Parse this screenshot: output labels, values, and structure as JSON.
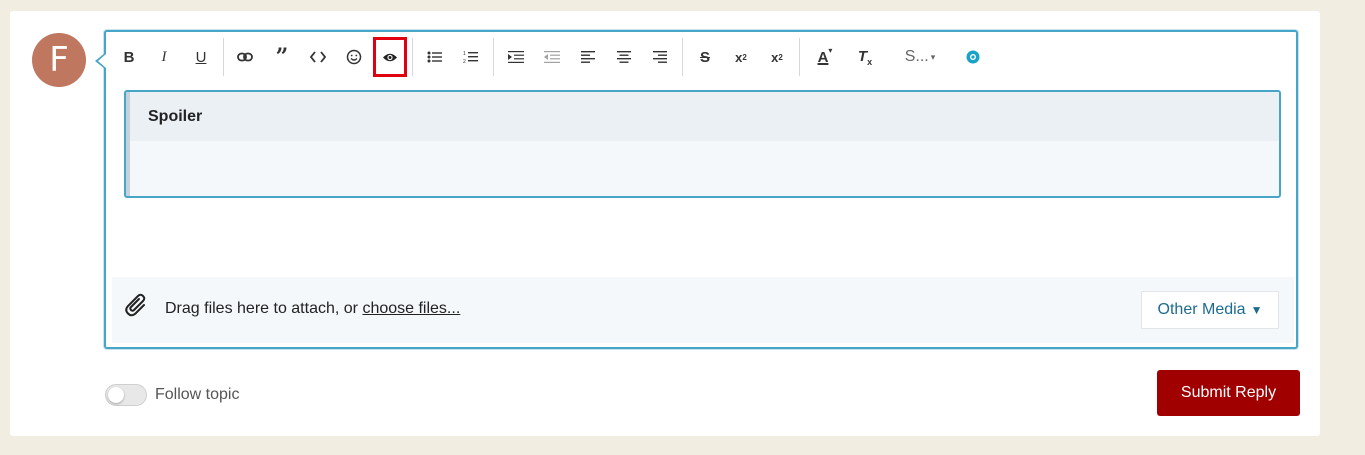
{
  "avatar": {
    "initial": "F",
    "color": "#c0775f"
  },
  "toolbar": {
    "buttons": [
      {
        "name": "bold",
        "glyph": "B"
      },
      {
        "name": "italic",
        "glyph": "I"
      },
      {
        "name": "underline",
        "glyph": "U"
      },
      {
        "name": "link",
        "glyph": "link-icon"
      },
      {
        "name": "quote",
        "glyph": "quote-icon"
      },
      {
        "name": "code",
        "glyph": "<>"
      },
      {
        "name": "emoji",
        "glyph": "smiley-icon"
      },
      {
        "name": "spoiler",
        "glyph": "eye-icon",
        "active": true
      },
      {
        "name": "bulleted-list",
        "glyph": "bullet-list-icon"
      },
      {
        "name": "numbered-list",
        "glyph": "numbered-list-icon"
      },
      {
        "name": "indent",
        "glyph": "indent-icon"
      },
      {
        "name": "outdent",
        "glyph": "outdent-icon"
      },
      {
        "name": "align-left",
        "glyph": "align-left-icon"
      },
      {
        "name": "align-center",
        "glyph": "align-center-icon"
      },
      {
        "name": "align-right",
        "glyph": "align-right-icon"
      },
      {
        "name": "strikethrough",
        "glyph": "S"
      },
      {
        "name": "superscript",
        "glyph": "x²"
      },
      {
        "name": "subscript",
        "glyph": "x₂"
      },
      {
        "name": "font-color",
        "glyph": "A"
      },
      {
        "name": "clear-formatting",
        "glyph": "Tx"
      },
      {
        "name": "styles",
        "glyph": "S..."
      },
      {
        "name": "plugin",
        "glyph": "plugin-icon"
      }
    ],
    "styles_label": "S...",
    "active_color": "#e0000f"
  },
  "editor": {
    "spoiler_title": "Spoiler",
    "spoiler_body": ""
  },
  "attach": {
    "text": "Drag files here to attach, or ",
    "link": "choose files...",
    "other_media": "Other Media"
  },
  "footer": {
    "follow_label": "Follow topic",
    "follow_on": false,
    "submit_label": "Submit Reply",
    "submit_color": "#a00000"
  }
}
